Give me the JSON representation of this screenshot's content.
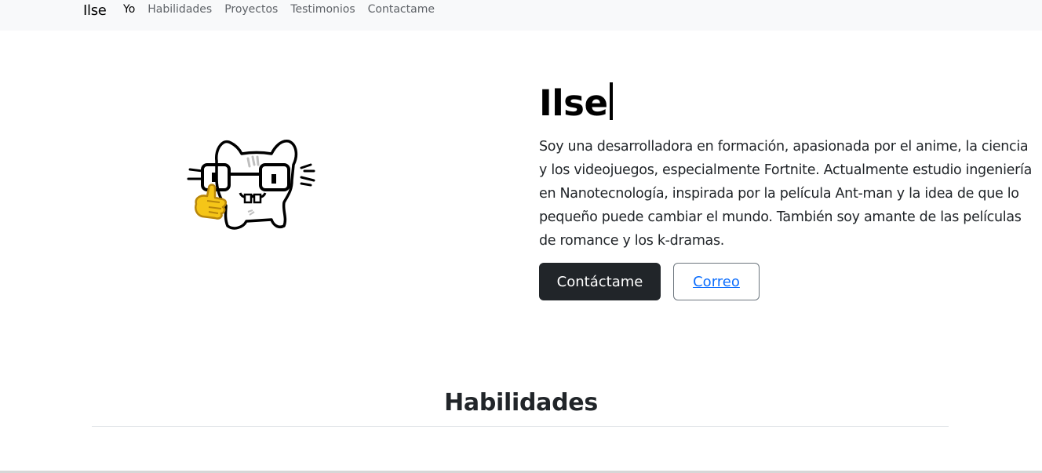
{
  "navbar": {
    "brand": "Ilse",
    "links": [
      {
        "label": "Yo",
        "active": true
      },
      {
        "label": "Habilidades",
        "active": false
      },
      {
        "label": "Proyectos",
        "active": false
      },
      {
        "label": "Testimonios",
        "active": false
      },
      {
        "label": "Contactame",
        "active": false
      }
    ]
  },
  "hero": {
    "image_icon": "cat-with-glasses-thumbs-up-icon",
    "title": "Ilse",
    "description": "Soy una desarrolladora en formación, apasionada por el anime, la ciencia y los videojuegos, especialmente Fortnite. Actualmente estudio ingeniería en Nanotecnología, inspirada por la película Ant-man y la idea de que lo pequeño puede cambiar el mundo. También soy amante de las películas de romance y los k-dramas.",
    "buttons": {
      "contact_label": "Contáctame",
      "email_label": "Correo"
    }
  },
  "sections": {
    "skills_title": "Habilidades"
  },
  "colors": {
    "navbar_bg": "#f8f9fa",
    "primary_button": "#212529",
    "link": "#0d6efd"
  }
}
